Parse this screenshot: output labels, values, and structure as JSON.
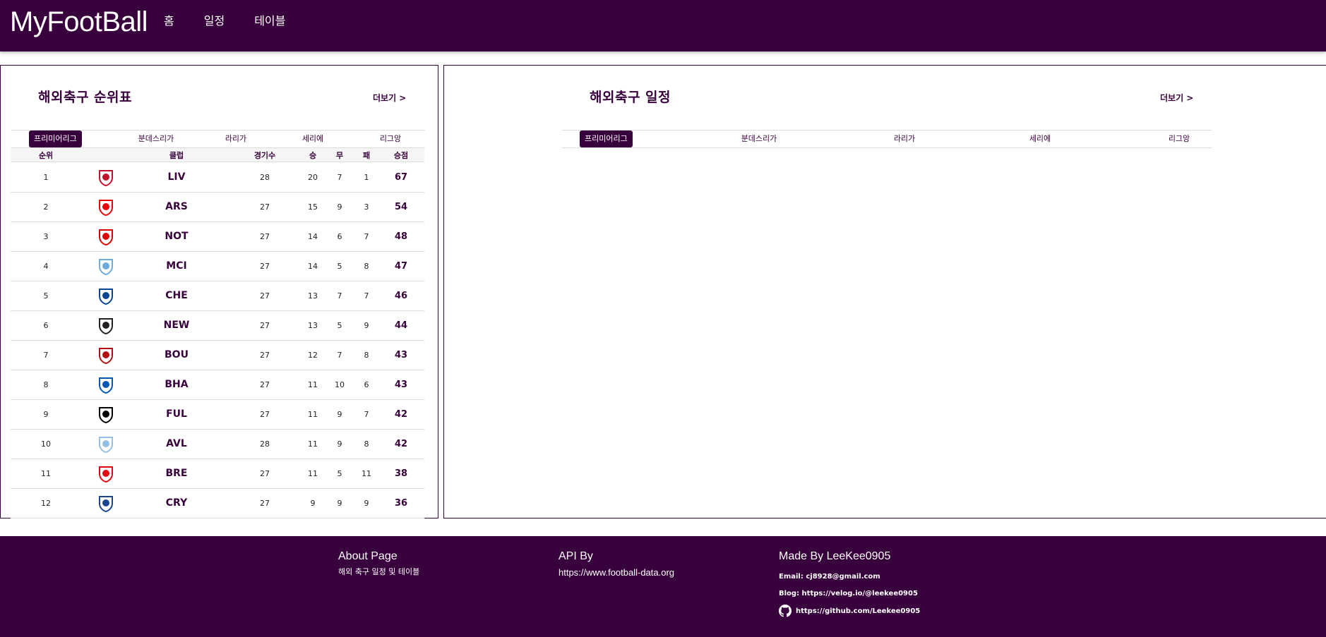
{
  "header": {
    "brand": "MyFootBall",
    "nav": [
      "홈",
      "일정",
      "테이블"
    ]
  },
  "standings": {
    "title": "해외축구 순위표",
    "more": "더보기 >",
    "tabs": [
      "프리미어리그",
      "분데스리가",
      "라리가",
      "세리에",
      "리그앙"
    ],
    "active_tab": "프리미어리그",
    "headers": {
      "rank": "순위",
      "club": "클럽",
      "played": "경기수",
      "won": "승",
      "draw": "무",
      "lost": "패",
      "points": "승점"
    },
    "rows": [
      {
        "rank": "1",
        "club": "LIV",
        "played": "28",
        "won": "20",
        "draw": "7",
        "lost": "1",
        "points": "67",
        "crest_color": "#c8102e"
      },
      {
        "rank": "2",
        "club": "ARS",
        "played": "27",
        "won": "15",
        "draw": "9",
        "lost": "3",
        "points": "54",
        "crest_color": "#ef0107"
      },
      {
        "rank": "3",
        "club": "NOT",
        "played": "27",
        "won": "14",
        "draw": "6",
        "lost": "7",
        "points": "48",
        "crest_color": "#dd0000"
      },
      {
        "rank": "4",
        "club": "MCI",
        "played": "27",
        "won": "14",
        "draw": "5",
        "lost": "8",
        "points": "47",
        "crest_color": "#6cabdd"
      },
      {
        "rank": "5",
        "club": "CHE",
        "played": "27",
        "won": "13",
        "draw": "7",
        "lost": "7",
        "points": "46",
        "crest_color": "#034694"
      },
      {
        "rank": "6",
        "club": "NEW",
        "played": "27",
        "won": "13",
        "draw": "5",
        "lost": "9",
        "points": "44",
        "crest_color": "#241f20"
      },
      {
        "rank": "7",
        "club": "BOU",
        "played": "27",
        "won": "12",
        "draw": "7",
        "lost": "8",
        "points": "43",
        "crest_color": "#b50e12"
      },
      {
        "rank": "8",
        "club": "BHA",
        "played": "27",
        "won": "11",
        "draw": "10",
        "lost": "6",
        "points": "43",
        "crest_color": "#0057b8"
      },
      {
        "rank": "9",
        "club": "FUL",
        "played": "27",
        "won": "11",
        "draw": "9",
        "lost": "7",
        "points": "42",
        "crest_color": "#000000"
      },
      {
        "rank": "10",
        "club": "AVL",
        "played": "28",
        "won": "11",
        "draw": "9",
        "lost": "8",
        "points": "42",
        "crest_color": "#95bfe5"
      },
      {
        "rank": "11",
        "club": "BRE",
        "played": "27",
        "won": "11",
        "draw": "5",
        "lost": "11",
        "points": "38",
        "crest_color": "#e30613"
      },
      {
        "rank": "12",
        "club": "CRY",
        "played": "27",
        "won": "9",
        "draw": "9",
        "lost": "9",
        "points": "36",
        "crest_color": "#1b458f"
      }
    ]
  },
  "schedule": {
    "title": "해외축구 일정",
    "more": "더보기 >",
    "tabs": [
      "프리미어리그",
      "분데스리가",
      "라리가",
      "세리에",
      "리그앙"
    ],
    "active_tab": "프리미어리그"
  },
  "footer": {
    "about_title": "About Page",
    "about_sub": "해외 축구 일정 및 테이블",
    "api_title": "API By",
    "api_url": "https://www.football-data.org",
    "made_title": "Made By LeeKee0905",
    "email": "Email: cj8928@gmail.com",
    "blog": "Blog: https://velog.io/@leekee0905",
    "github": "https://github.com/Leekee0905"
  },
  "colors": {
    "brand": "#38003c"
  }
}
